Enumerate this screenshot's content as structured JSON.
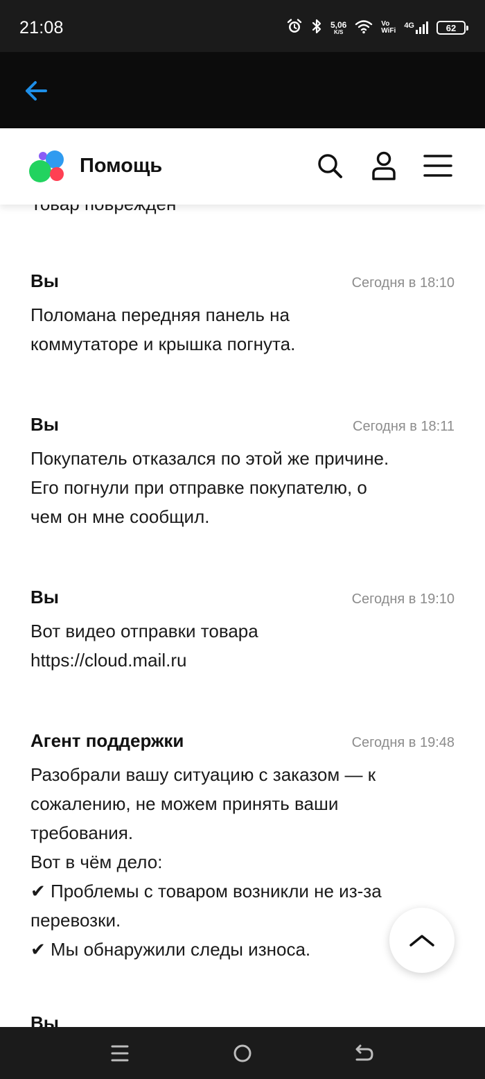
{
  "status_bar": {
    "time": "21:08",
    "speed_value": "5,06",
    "speed_unit": "K/S",
    "vowifi_top": "Vo",
    "vowifi_bottom": "WiFi",
    "network": "4G",
    "battery": "62"
  },
  "icons": {
    "back": "arrow-left-icon",
    "search": "search-icon",
    "profile": "user-icon",
    "menu": "hamburger-menu-icon",
    "alarm": "alarm-icon",
    "bluetooth": "bluetooth-icon",
    "wifi": "wifi-icon",
    "scroll_top": "chevron-up-icon",
    "nav_recents": "recents-icon",
    "nav_home": "home-icon",
    "nav_back": "back-icon"
  },
  "colors": {
    "accent_blue": "#1e8fe8",
    "logo_purple": "#8a5cf6",
    "logo_blue": "#2f9bf0",
    "logo_green": "#22d35f",
    "logo_red": "#ff4053"
  },
  "header": {
    "title": "Помощь"
  },
  "messages": [
    {
      "author": "",
      "time": "",
      "text": "Товар поврежден"
    },
    {
      "author": "Вы",
      "time": "Сегодня в 18:10",
      "text": "Поломана передняя панель на\nкоммутаторе и крышка погнута."
    },
    {
      "author": "Вы",
      "time": "Сегодня в 18:11",
      "text": "Покупатель отказался по этой же причине.\nЕго погнули при отправке покупателю, о\nчем он мне сообщил."
    },
    {
      "author": "Вы",
      "time": "Сегодня в 19:10",
      "text": "Вот видео отправки товара",
      "link": "https://cloud.mail.ru"
    },
    {
      "author": "Агент поддержки",
      "time": "Сегодня в 19:48",
      "text": "Разобрали вашу ситуацию с заказом — к\nсожалению, не можем принять ваши\nтребования.\nВот в чём дело:\n✔ Проблемы с товаром возникли не из-за\nперевозки.\n✔ Мы обнаружили следы износа."
    },
    {
      "author": "Вы",
      "time": "",
      "text": ""
    }
  ]
}
